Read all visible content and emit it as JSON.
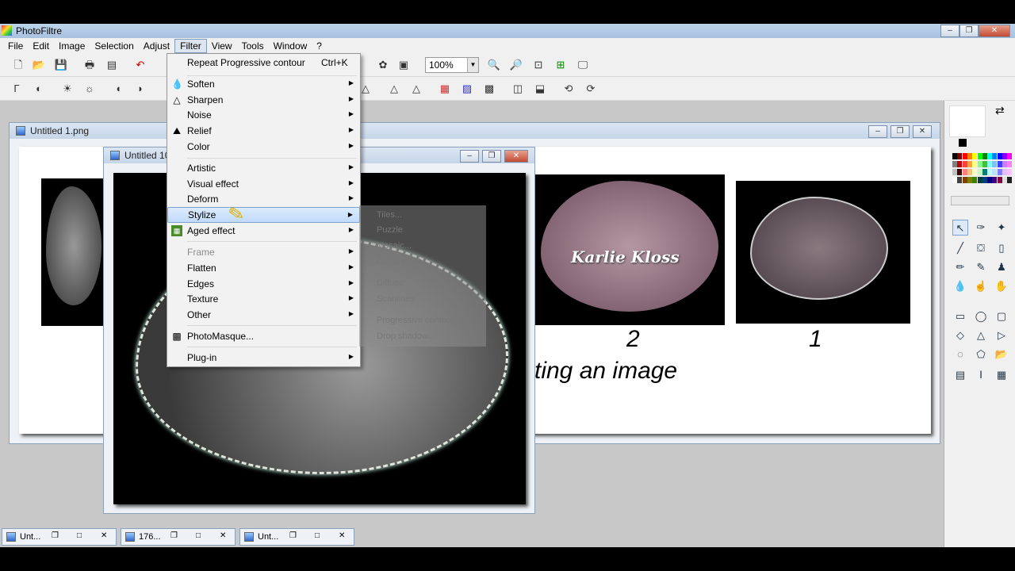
{
  "app": {
    "title": "PhotoFiltre"
  },
  "menubar": [
    "File",
    "Edit",
    "Image",
    "Selection",
    "Adjust",
    "Filter",
    "View",
    "Tools",
    "Window",
    "?"
  ],
  "zoom": "100%",
  "windows": {
    "back": {
      "title": "Untitled 1.png",
      "caption": "ting an image",
      "label_2": "2",
      "label_1": "1",
      "watermark": "Karlie Kloss"
    },
    "front": {
      "title": "Untitled 10"
    }
  },
  "filter_menu": {
    "repeat": {
      "label": "Repeat Progressive contour",
      "shortcut": "Ctrl+K"
    },
    "items": [
      {
        "label": "Soften",
        "sub": true,
        "dis": false
      },
      {
        "label": "Sharpen",
        "sub": true,
        "dis": false
      },
      {
        "label": "Noise",
        "sub": true,
        "dis": false
      },
      {
        "label": "Relief",
        "sub": true,
        "dis": false
      },
      {
        "label": "Color",
        "sub": true,
        "dis": false
      },
      {
        "label": "Artistic",
        "sub": true,
        "dis": false
      },
      {
        "label": "Visual effect",
        "sub": true,
        "dis": false
      },
      {
        "label": "Deform",
        "sub": true,
        "dis": false
      },
      {
        "label": "Stylize",
        "sub": true,
        "dis": false
      },
      {
        "label": "Aged effect",
        "sub": true,
        "dis": false
      },
      {
        "label": "Frame",
        "sub": true,
        "dis": true
      },
      {
        "label": "Flatten",
        "sub": true,
        "dis": false
      },
      {
        "label": "Edges",
        "sub": true,
        "dis": false
      },
      {
        "label": "Texture",
        "sub": true,
        "dis": false
      },
      {
        "label": "Other",
        "sub": true,
        "dis": false
      },
      {
        "label": "PhotoMasque...",
        "sub": false,
        "dis": false
      },
      {
        "label": "Plug-in",
        "sub": true,
        "dis": false
      }
    ]
  },
  "stylize_submenu": [
    "Tiles...",
    "Puzzle",
    "Mosaic...",
    "Cross-point...",
    "Diffuse",
    "Scanlines",
    "Progressive contour...",
    "Drop shadow..."
  ],
  "taskbar": [
    "Unt...",
    "176...",
    "Unt..."
  ],
  "palette": [
    "#000000",
    "#800000",
    "#ff0000",
    "#ff8000",
    "#ffff00",
    "#00ff00",
    "#008000",
    "#00ffff",
    "#0080ff",
    "#0000ff",
    "#8000ff",
    "#ff00ff",
    "#808080",
    "#c00000",
    "#ff4040",
    "#ffa040",
    "#ffff80",
    "#80ff80",
    "#40c040",
    "#80ffff",
    "#80c0ff",
    "#4040ff",
    "#c080ff",
    "#ff80ff",
    "#c0c0c0",
    "#400000",
    "#ff8080",
    "#ffc080",
    "#ffffc0",
    "#c0ffc0",
    "#008080",
    "#c0ffff",
    "#c0e0ff",
    "#8080ff",
    "#e0c0ff",
    "#ffc0ff",
    "#ffffff",
    "#404040",
    "#804000",
    "#808000",
    "#408000",
    "#004040",
    "#004080",
    "#000080",
    "#400080",
    "#800040",
    "#e0e0e0",
    "#202020"
  ]
}
